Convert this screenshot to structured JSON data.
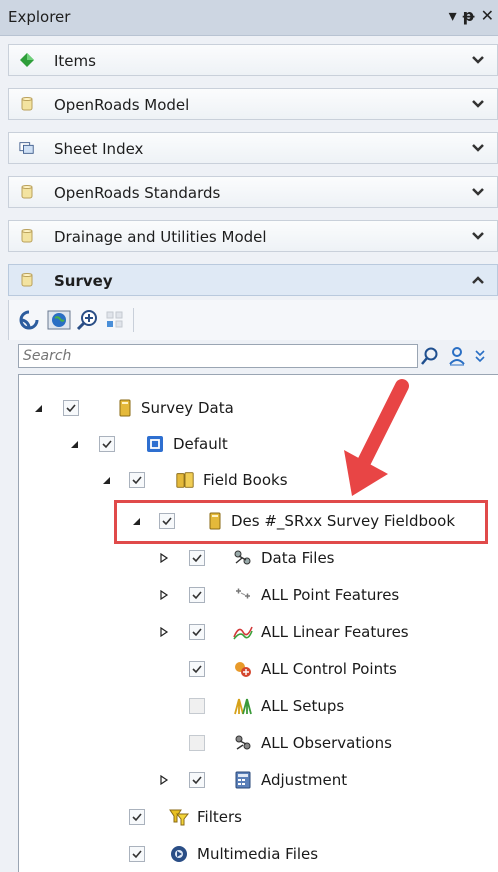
{
  "panel": {
    "title": "Explorer"
  },
  "sections": [
    {
      "label": "Items",
      "icon": "diamond-green-icon"
    },
    {
      "label": "OpenRoads Model",
      "icon": "cylinder-icon"
    },
    {
      "label": "Sheet Index",
      "icon": "sheet-index-icon"
    },
    {
      "label": "OpenRoads Standards",
      "icon": "cylinder-icon"
    },
    {
      "label": "Drainage and Utilities Model",
      "icon": "cylinder-icon"
    },
    {
      "label": "Survey",
      "icon": "cylinder-icon",
      "expanded": true
    }
  ],
  "search": {
    "placeholder": "Search",
    "value": ""
  },
  "tree": [
    {
      "label": "Survey Data",
      "expander": "expanded",
      "checked": true,
      "icon": "survey-data-icon"
    },
    {
      "label": "Default",
      "expander": "expanded",
      "checked": true,
      "icon": "default-project-icon"
    },
    {
      "label": "Field Books",
      "expander": "expanded",
      "checked": true,
      "icon": "field-books-icon"
    },
    {
      "label": "Des #_SRxx Survey Fieldbook",
      "expander": "expanded",
      "checked": true,
      "icon": "fieldbook-icon",
      "highlighted": true
    },
    {
      "label": "Data Files",
      "expander": "collapsed",
      "checked": true,
      "icon": "data-files-icon"
    },
    {
      "label": "ALL Point Features",
      "expander": "collapsed",
      "checked": true,
      "icon": "point-features-icon"
    },
    {
      "label": "ALL Linear Features",
      "expander": "collapsed",
      "checked": true,
      "icon": "linear-features-icon"
    },
    {
      "label": "ALL Control Points",
      "expander": "none",
      "checked": true,
      "icon": "control-points-icon"
    },
    {
      "label": "ALL Setups",
      "expander": "none",
      "checked": false,
      "icon": "setups-icon"
    },
    {
      "label": "ALL Observations",
      "expander": "none",
      "checked": false,
      "icon": "observations-icon"
    },
    {
      "label": "Adjustment",
      "expander": "collapsed",
      "checked": true,
      "icon": "adjustment-icon"
    },
    {
      "label": "Filters",
      "expander": "none",
      "checked": true,
      "icon": "filters-icon"
    },
    {
      "label": "Multimedia Files",
      "expander": "none",
      "checked": true,
      "icon": "multimedia-icon"
    }
  ],
  "colors": {
    "highlight": "#e04a4a",
    "arrow": "#e84545"
  }
}
